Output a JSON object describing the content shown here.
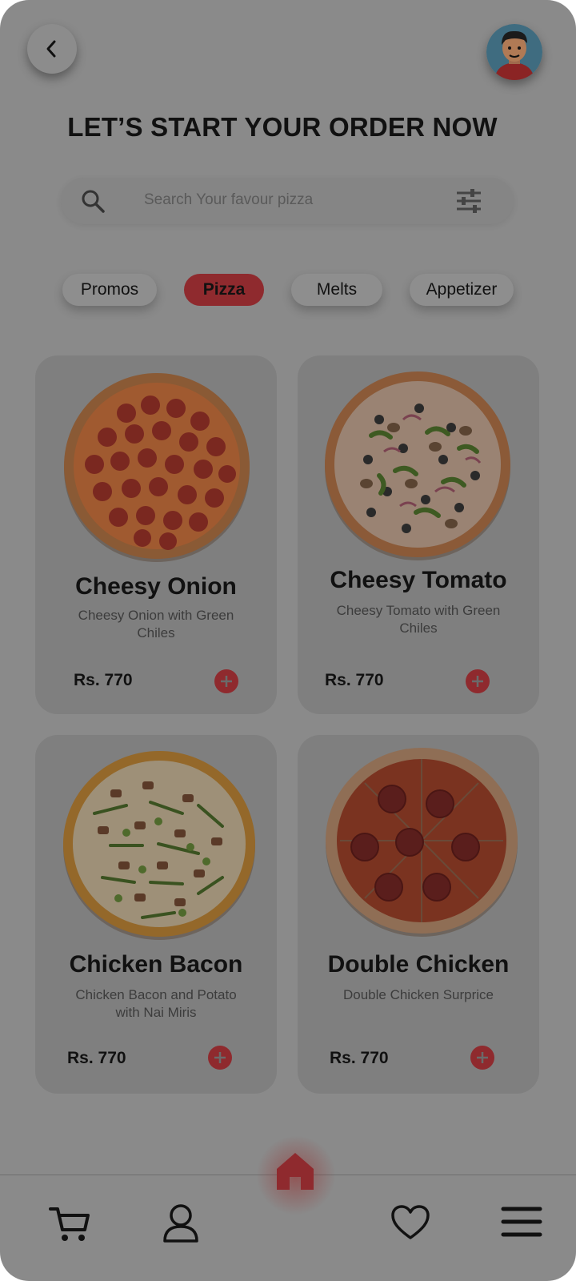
{
  "header": {
    "title": "LET’S START YOUR ORDER NOW",
    "back_icon": "chevron-left-icon",
    "avatar_icon": "user-avatar-icon"
  },
  "search": {
    "placeholder": "Search Your favour pizza",
    "search_icon": "search-icon",
    "filter_icon": "sliders-icon"
  },
  "categories": [
    {
      "label": "Promos",
      "active": false
    },
    {
      "label": "Pizza",
      "active": true
    },
    {
      "label": "Melts",
      "active": false
    },
    {
      "label": "Appetizer",
      "active": false
    }
  ],
  "products": [
    {
      "name": "Cheesy Onion",
      "description": "Cheesy Onion with Green Chiles",
      "price": "Rs. 770",
      "image": "pepperoni-pizza-image"
    },
    {
      "name": "Cheesy Tomato",
      "description": "Cheesy Tomato with Green Chiles",
      "price": "Rs. 770",
      "image": "veggie-pizza-image"
    },
    {
      "name": "Chicken Bacon",
      "description": "Chicken Bacon and Potato with Nai Miris",
      "price": "Rs. 770",
      "image": "chicken-pizza-image"
    },
    {
      "name": "Double Chicken",
      "description": "Double Chicken Surprice",
      "price": "Rs. 770",
      "image": "salami-pizza-image"
    }
  ],
  "bottom_nav": {
    "items": [
      "cart-icon",
      "profile-icon",
      "home-icon",
      "heart-icon",
      "menu-icon"
    ],
    "active": "home-icon"
  },
  "colors": {
    "accent": "#8f2a2e",
    "overlay_background": "#8a8a8a",
    "card": "#7f7f7f"
  }
}
